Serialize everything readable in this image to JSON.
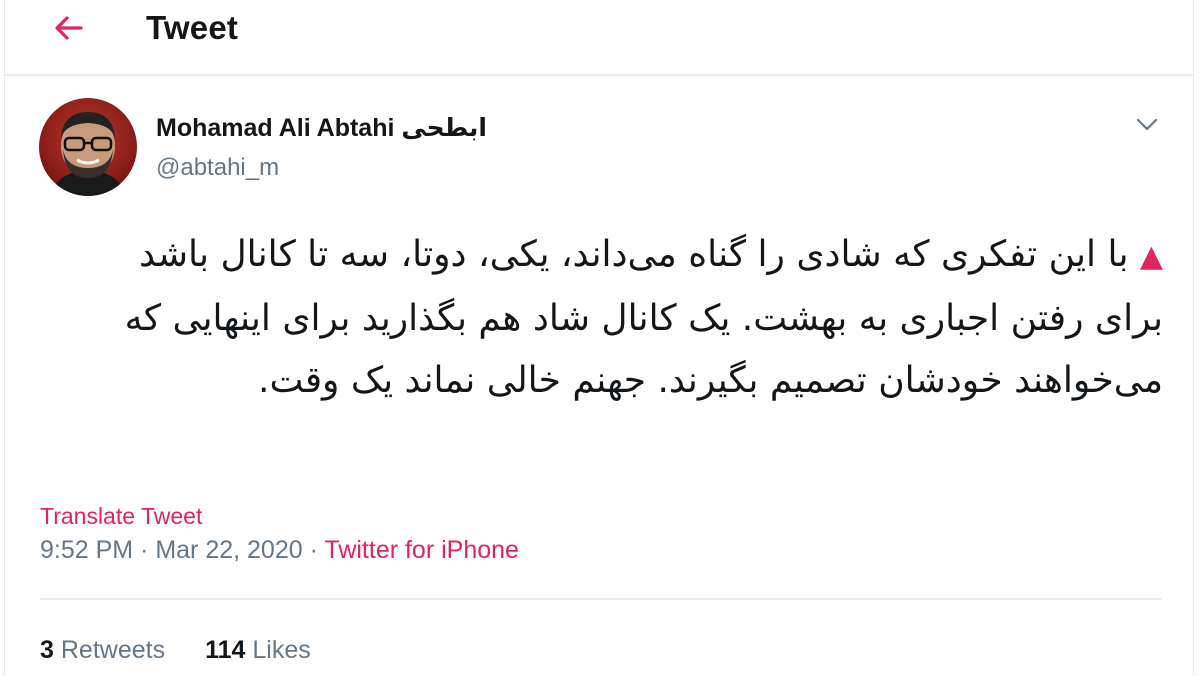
{
  "header": {
    "title": "Tweet",
    "back_icon": "arrow-left-icon"
  },
  "author": {
    "name": "Mohamad Ali Abtahi ابطحی",
    "handle": "@abtahi_m",
    "avatar_icon": "avatar-photo"
  },
  "menu": {
    "icon": "chevron-down-icon"
  },
  "tweet": {
    "marker": "▲",
    "text": "با این تفکری که شادی را گناه می‌داند، یکی، دوتا، سه تا کانال باشد برای رفتن اجباری به بهشت. یک کانال شاد هم بگذارید برای اینهایی که می‌خواهند خودشان تصمیم بگیرند. جهنم خالی نماند یک وقت."
  },
  "translate_label": "Translate Tweet",
  "meta": {
    "time": "9:52 PM",
    "separator": " · ",
    "date": "Mar 22, 2020",
    "source": "Twitter for iPhone"
  },
  "stats": {
    "retweets_count": "3",
    "retweets_label": "Retweets",
    "likes_count": "114",
    "likes_label": "Likes"
  },
  "colors": {
    "accent": "#e0245e",
    "text": "#14171a",
    "secondary": "#657786",
    "border": "#e6ecf0"
  }
}
